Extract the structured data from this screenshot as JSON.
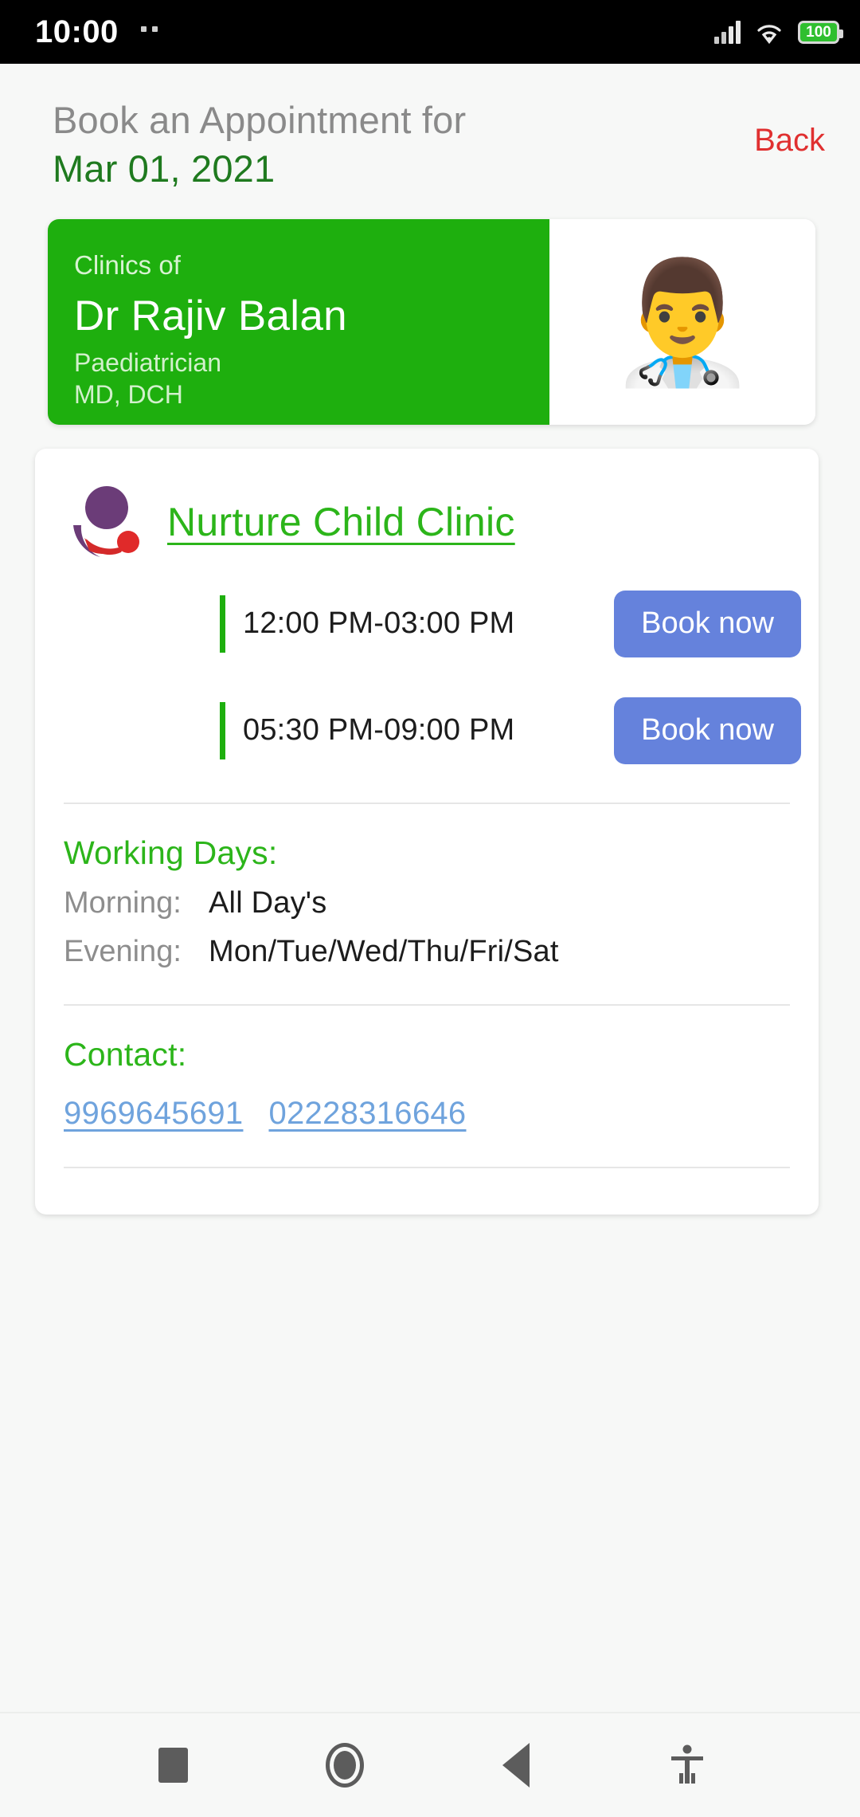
{
  "status_bar": {
    "time": "10:00",
    "battery_level": "100",
    "icons": [
      "signal-icon",
      "wifi-icon",
      "battery-icon"
    ]
  },
  "header": {
    "title": "Book an Appointment for",
    "date": "Mar 01, 2021",
    "back_label": "Back"
  },
  "doctor_card": {
    "clinics_of_label": "Clinics of",
    "name": "Dr Rajiv Balan",
    "specialty": "Paediatrician",
    "degrees": "MD, DCH",
    "avatar_emoji": "👨‍⚕️",
    "background_color": "#1eaf0e"
  },
  "clinic": {
    "name": "Nurture Child Clinic",
    "logo_name": "nurture-child-clinic-logo",
    "slots": [
      {
        "time": "12:00 PM-03:00 PM",
        "button_label": "Book now"
      },
      {
        "time": "05:30 PM-09:00 PM",
        "button_label": "Book now"
      }
    ],
    "working_days": {
      "title": "Working Days:",
      "rows": [
        {
          "key": "Morning:",
          "value": "All Day's"
        },
        {
          "key": "Evening:",
          "value": "Mon/Tue/Wed/Thu/Fri/Sat"
        }
      ]
    },
    "contact": {
      "title": "Contact:",
      "numbers": [
        "9969645691",
        "02228316646"
      ]
    }
  },
  "nav_bar": {
    "items": [
      {
        "name": "recents-button"
      },
      {
        "name": "home-button"
      },
      {
        "name": "back-button"
      },
      {
        "name": "accessibility-button"
      }
    ]
  },
  "colors": {
    "brand_green": "#1eaf0e",
    "link_green": "#2cb51a",
    "date_green": "#1f7a1f",
    "button_blue": "#6582dc",
    "back_red": "#e03030",
    "phone_link_blue": "#6fa3dd"
  }
}
